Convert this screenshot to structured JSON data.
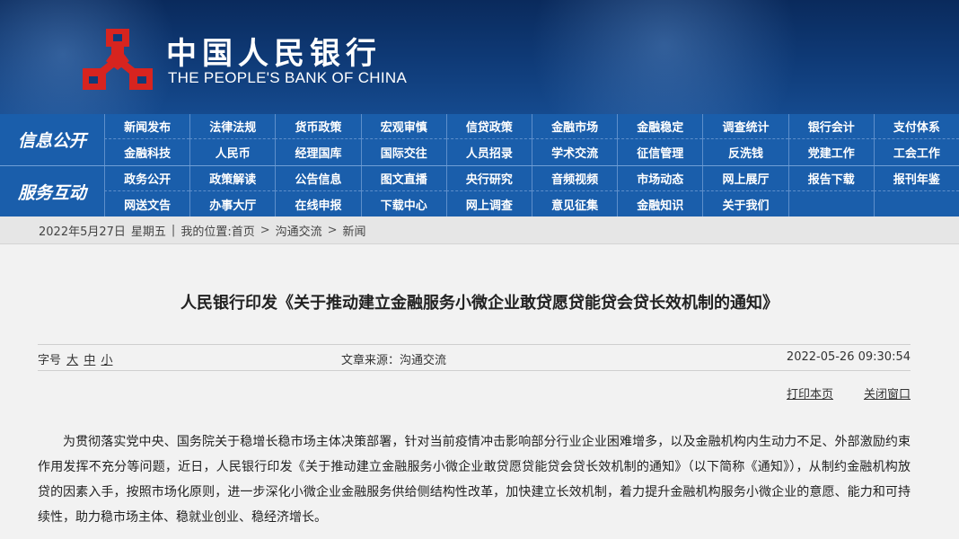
{
  "header": {
    "brand_cn": "中国人民银行",
    "brand_en": "THE PEOPLE'S BANK OF CHINA",
    "logo_icon": "pboc-emblem-icon",
    "colors": {
      "banner": "#0f3b78",
      "nav": "#1a5eab",
      "logo": "#d7241f"
    }
  },
  "nav": {
    "section1": {
      "label": "信息公开",
      "row1": [
        "新闻发布",
        "法律法规",
        "货币政策",
        "宏观审慎",
        "信贷政策",
        "金融市场",
        "金融稳定",
        "调查统计",
        "银行会计",
        "支付体系"
      ],
      "row2": [
        "金融科技",
        "人民币",
        "经理国库",
        "国际交往",
        "人员招录",
        "学术交流",
        "征信管理",
        "反洗钱",
        "党建工作",
        "工会工作"
      ]
    },
    "section2": {
      "label": "服务互动",
      "row1": [
        "政务公开",
        "政策解读",
        "公告信息",
        "图文直播",
        "央行研究",
        "音频视频",
        "市场动态",
        "网上展厅",
        "报告下载",
        "报刊年鉴"
      ],
      "row2": [
        "网送文告",
        "办事大厅",
        "在线申报",
        "下载中心",
        "网上调查",
        "意见征集",
        "金融知识",
        "关于我们"
      ]
    }
  },
  "breadcrumb": {
    "date": "2022年5月27日",
    "weekday": "星期五",
    "label": "我的位置:",
    "items": [
      "首页",
      "沟通交流",
      "新闻"
    ]
  },
  "article": {
    "title": "人民银行印发《关于推动建立金融服务小微企业敢贷愿贷能贷会贷长效机制的通知》",
    "font_size_label": "字号",
    "font_size_options": [
      "大",
      "中",
      "小"
    ],
    "source": "文章来源：沟通交流",
    "datetime": "2022-05-26 09:30:54",
    "print_label": "打印本页",
    "close_label": "关闭窗口",
    "paragraph": "为贯彻落实党中央、国务院关于稳增长稳市场主体决策部署，针对当前疫情冲击影响部分行业企业困难增多，以及金融机构内生动力不足、外部激励约束作用发挥不充分等问题，近日，人民银行印发《关于推动建立金融服务小微企业敢贷愿贷能贷会贷长效机制的通知》（以下简称《通知》），从制约金融机构放贷的因素入手，按照市场化原则，进一步深化小微企业金融服务供给侧结构性改革，加快建立长效机制，着力提升金融机构服务小微企业的意愿、能力和可持续性，助力稳市场主体、稳就业创业、稳经济增长。"
  }
}
